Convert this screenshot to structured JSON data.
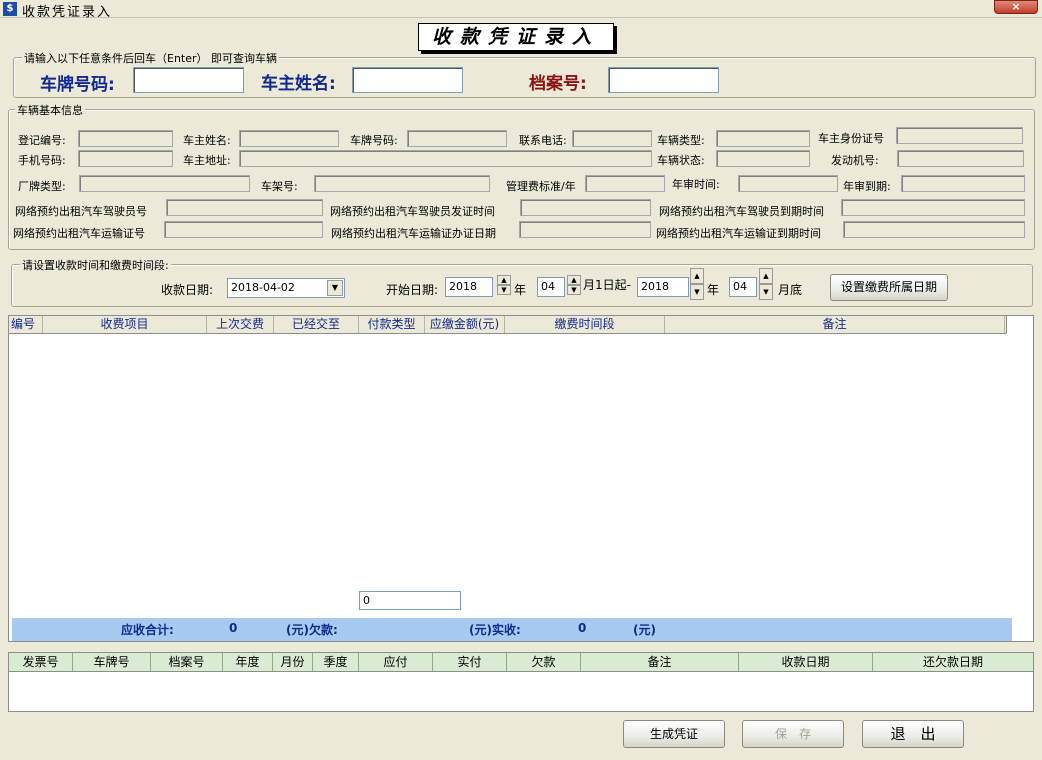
{
  "window": {
    "title": "收款凭证录入",
    "close_symbol": "×"
  },
  "form_title": "收款凭证录入",
  "query": {
    "legend": "请输入以下任意条件后回车（Enter） 即可查询车辆",
    "plate_label": "车牌号码:",
    "owner_label": "车主姓名:",
    "archive_label": "档案号:"
  },
  "vehicle_info": {
    "legend": "车辆基本信息",
    "registration_no": "登记编号:",
    "owner_name": "车主姓名:",
    "plate_no": "车牌号码:",
    "contact_phone": "联系电话:",
    "vehicle_type": "车辆类型:",
    "owner_id": "车主身份证号",
    "mobile": "手机号码:",
    "owner_address": "车主地址:",
    "vehicle_status": "车辆状态:",
    "engine_no": "发动机号:",
    "brand_type": "厂牌类型:",
    "frame_no": "车架号:",
    "mgmt_fee": "管理费标准/年",
    "inspection_time": "年审时间:",
    "inspection_due": "年审到期:",
    "driver_no": "网络预约出租汽车驾驶员号",
    "driver_issue": "网络预约出租汽车驾驶员发证时间",
    "driver_expire": "网络预约出租汽车驾驶员到期时间",
    "transport_no": "网络预约出租汽车运输证号",
    "transport_issue": "网络预约出租汽车运输证办证日期",
    "transport_expire": "网络预约出租汽车运输证到期时间"
  },
  "payment_period": {
    "legend": "请设置收款时间和缴费时间段:",
    "receipt_date_label": "收款日期:",
    "receipt_date": "2018-04-02",
    "start_label": "开始日期:",
    "start_year": "2018",
    "year_unit": "年",
    "start_month": "04",
    "start_suffix": "月1日起-",
    "end_year": "2018",
    "end_month": "04",
    "end_suffix": "月底",
    "set_button": "设置缴费所属日期"
  },
  "fee_grid": {
    "columns": [
      "编号",
      "收费项目",
      "上次交费",
      "已经交至",
      "付款类型",
      "应缴金额(元)",
      "缴费时间段",
      "备注"
    ],
    "total_value": "0"
  },
  "summary": {
    "receivable_label": "应收合计:",
    "receivable_value": "0",
    "arrears_label": "(元)欠款:",
    "paid_label": "(元)实收:",
    "paid_value": "0",
    "unit": "(元)"
  },
  "history_grid": {
    "columns": [
      "发票号",
      "车牌号",
      "档案号",
      "年度",
      "月份",
      "季度",
      "应付",
      "实付",
      "欠款",
      "备注",
      "收款日期",
      "还欠款日期"
    ]
  },
  "buttons": {
    "generate": "生成凭证",
    "save": "保　存",
    "exit": "退　出"
  }
}
